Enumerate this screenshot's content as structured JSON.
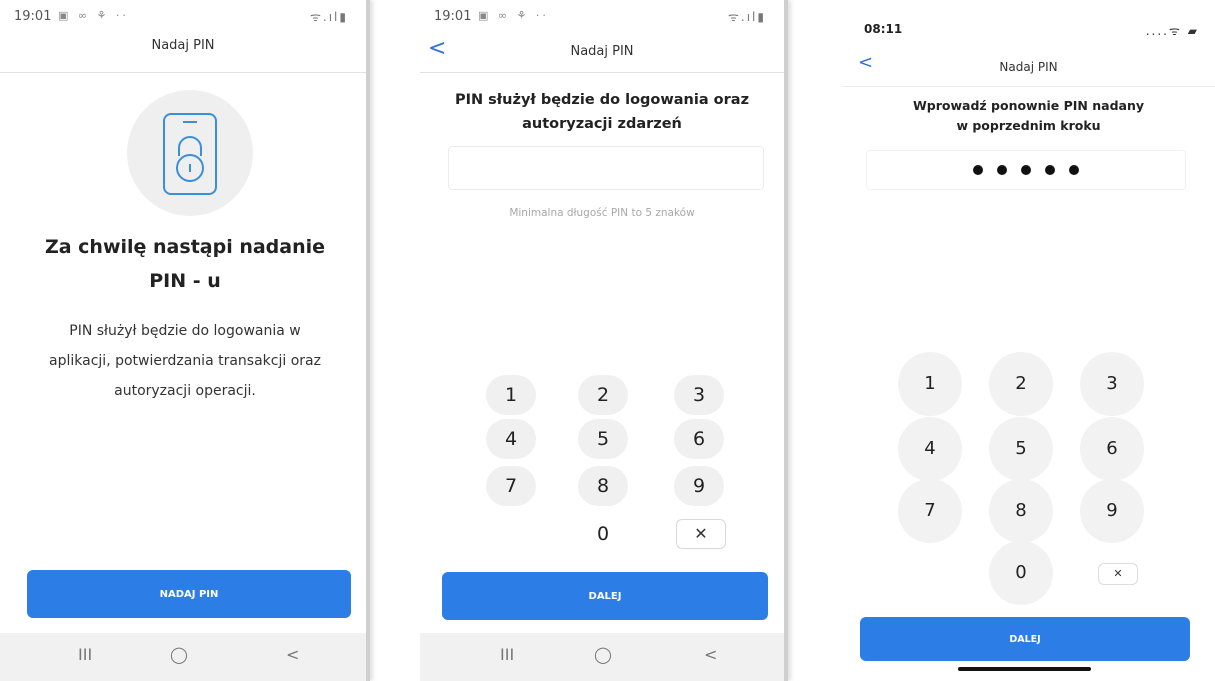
{
  "screen1": {
    "status": {
      "time": "19:01",
      "icons": "▣ ∞ ⚘ ··",
      "right": "ᯤ.ıl▮"
    },
    "title": "Nadaj PIN",
    "heading": "Za chwilę nastąpi nadanie PIN - u",
    "body": "PIN służył będzie do logowania w aplikacji, potwierdzania transakcji oraz autoryzacji operacji.",
    "button": "NADAJ PIN",
    "nav": {
      "recent": "III",
      "home": "◯",
      "back": "<"
    }
  },
  "screen2": {
    "status": {
      "time": "19:01",
      "icons": "▣ ∞ ⚘ ··",
      "right": "ᯤ.ıl▮"
    },
    "back": "<",
    "title": "Nadaj PIN",
    "heading": "PIN służył będzie do logowania oraz autoryzacji zdarzeń",
    "hint": "Minimalna długość PIN to 5 znaków",
    "keys": {
      "k1": "1",
      "k2": "2",
      "k3": "3",
      "k4": "4",
      "k5": "5",
      "k6": "6",
      "k7": "7",
      "k8": "8",
      "k9": "9",
      "k0": "0",
      "del": "✕"
    },
    "button": "DALEJ",
    "nav": {
      "recent": "III",
      "home": "◯",
      "back": "<"
    }
  },
  "screen3": {
    "status": {
      "time": "08:11",
      "right": "....ᯤ ▰"
    },
    "back": "<",
    "title": "Nadaj PIN",
    "heading_line1": "Wprowadź ponownie PIN nadany",
    "heading_line2": "w poprzednim kroku",
    "pin_length": 5,
    "keys": {
      "k1": "1",
      "k2": "2",
      "k3": "3",
      "k4": "4",
      "k5": "5",
      "k6": "6",
      "k7": "7",
      "k8": "8",
      "k9": "9",
      "k0": "0",
      "del": "✕"
    },
    "button": "DALEJ"
  },
  "colors": {
    "accent": "#2d7de6",
    "key_bg": "#f0f0f0",
    "illustration_stroke": "#3b8fd9"
  },
  "icons": {
    "lock": "phone-lock-icon",
    "back": "chevron-left-icon"
  }
}
